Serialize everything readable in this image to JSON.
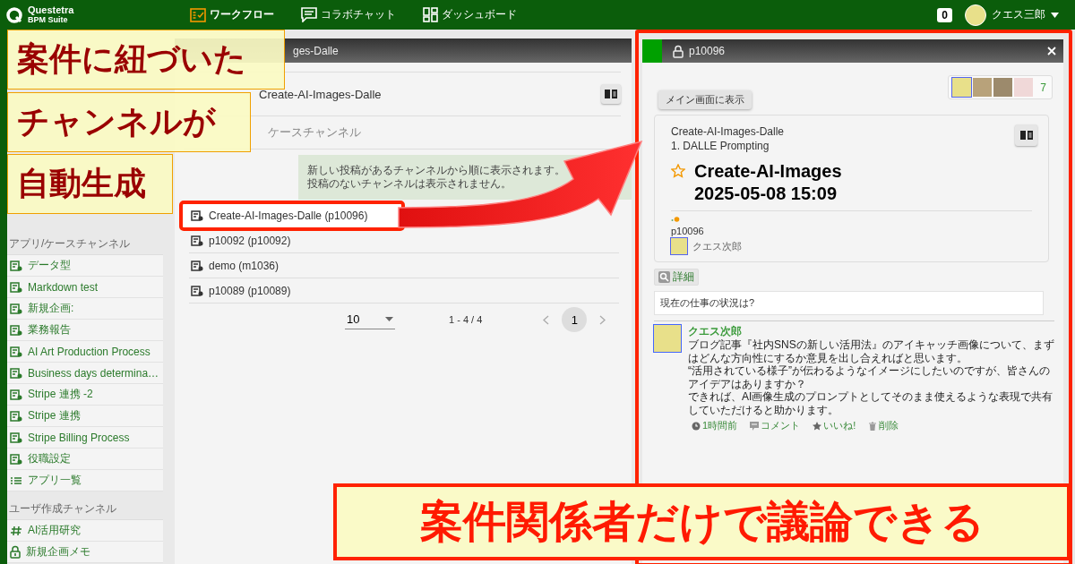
{
  "top_bar": {
    "logo_line1": "Questetra",
    "logo_line2": "BPM Suite",
    "nav": [
      {
        "label": "ワークフロー",
        "kind": "workflow",
        "selected": true
      },
      {
        "label": "コラボチャット",
        "kind": "chat",
        "selected": false
      },
      {
        "label": "ダッシュボード",
        "kind": "dashboard",
        "selected": false
      }
    ],
    "notification_count": "0",
    "user_name": "クエス三郎"
  },
  "sidebar": {
    "sections": [
      {
        "heading": "アプリ/ケースチャンネル",
        "items": [
          {
            "label": "データ型",
            "kind": "app"
          },
          {
            "label": "Markdown test",
            "kind": "app"
          },
          {
            "label": "新規企画:",
            "kind": "app"
          },
          {
            "label": "業務報告",
            "kind": "app"
          },
          {
            "label": "AI Art Production Process",
            "kind": "app"
          },
          {
            "label": "Business days determina…",
            "kind": "app"
          },
          {
            "label": "Stripe 連携 -2",
            "kind": "app"
          },
          {
            "label": "Stripe 連携",
            "kind": "app"
          },
          {
            "label": "Stripe Billing Process",
            "kind": "app"
          },
          {
            "label": "役職設定",
            "kind": "app"
          },
          {
            "label": "アプリ一覧",
            "kind": "list"
          }
        ]
      },
      {
        "heading": "ユーザ作成チャンネル",
        "items": [
          {
            "label": "AI活用研究",
            "kind": "public"
          },
          {
            "label": "新規企画メモ",
            "kind": "private"
          }
        ]
      }
    ]
  },
  "channel_panel": {
    "title": "ges-Dalle",
    "app_name": "Create-AI-Images-Dalle",
    "section_title": "ケースチャンネル",
    "notice": [
      "新しい投稿があるチャンネルから順に表示されます。",
      "投稿のないチャンネルは表示されません。"
    ],
    "channels": [
      {
        "label": "Create-AI-Images-Dalle (p10096)",
        "highlighted": true
      },
      {
        "label": "p10092 (p10092)",
        "highlighted": false
      },
      {
        "label": "demo (m1036)",
        "highlighted": false
      },
      {
        "label": "p10089 (p10089)",
        "highlighted": false
      }
    ],
    "per_page": "10",
    "range": "1 - 4 / 4",
    "pages": [
      {
        "label": "1",
        "selected": true
      }
    ]
  },
  "case_panel": {
    "title": "p10096",
    "show_main_button": "メイン画面に表示",
    "member_count": "7",
    "app_name": "Create-AI-Images-Dalle",
    "step": "1. DALLE Prompting",
    "case_title": "Create-AI-Images 2025-05-08 15:09",
    "starred": false,
    "case_id": "p10096",
    "owner": "クエス次郎",
    "details_button": "詳細",
    "question": "現在の仕事の状況は?",
    "post": {
      "author": "クエス次郎",
      "body": [
        "ブログ記事『社内SNSの新しい活用法』のアイキャッチ画像について、まずはどんな方向性にするか意見を出し合えればと思います。",
        "“活用されている様子”が伝わるようなイメージにしたいのですが、皆さんのアイデアはありますか？",
        "できれば、AI画像生成のプロンプトとしてそのまま使えるような表現で共有していただけると助かります。"
      ],
      "actions": [
        {
          "label": "1時間前",
          "kind": "time"
        },
        {
          "label": "コメント",
          "kind": "comment"
        },
        {
          "label": "いいね!",
          "kind": "like"
        },
        {
          "label": "削除",
          "kind": "delete"
        }
      ]
    }
  },
  "callouts": [
    "案件に紐づいた",
    "チャンネルが",
    "自動生成"
  ],
  "bottom_callout": "案件関係者だけで議論できる"
}
